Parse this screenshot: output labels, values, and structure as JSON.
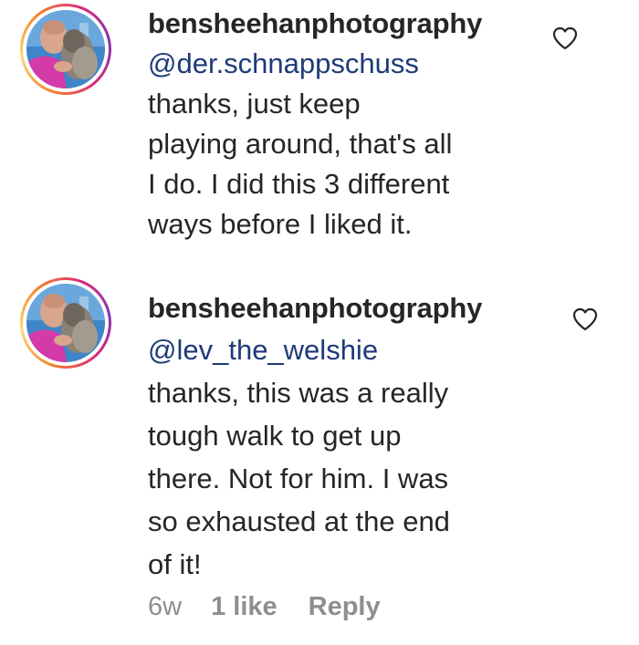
{
  "comments": [
    {
      "username": "bensheehanphotography",
      "mention": "@der.schnappschuss",
      "lines": [
        "thanks, just keep",
        "playing around, that's all",
        "I do. I did this 3 different",
        "ways before I liked it."
      ],
      "heart_icon": "heart-outline-icon"
    },
    {
      "username": "bensheehanphotography",
      "mention": "@lev_the_welshie",
      "lines": [
        "thanks, this was a really",
        "tough walk to get up",
        "there. Not for him. I was",
        "so exhausted at the end",
        "of it!"
      ],
      "heart_icon": "heart-outline-icon",
      "meta": {
        "time": "6w",
        "likes": "1 like",
        "reply": "Reply"
      }
    }
  ],
  "colors": {
    "text": "#262626",
    "mention": "#1e3a78",
    "meta": "#8e8e8e"
  }
}
